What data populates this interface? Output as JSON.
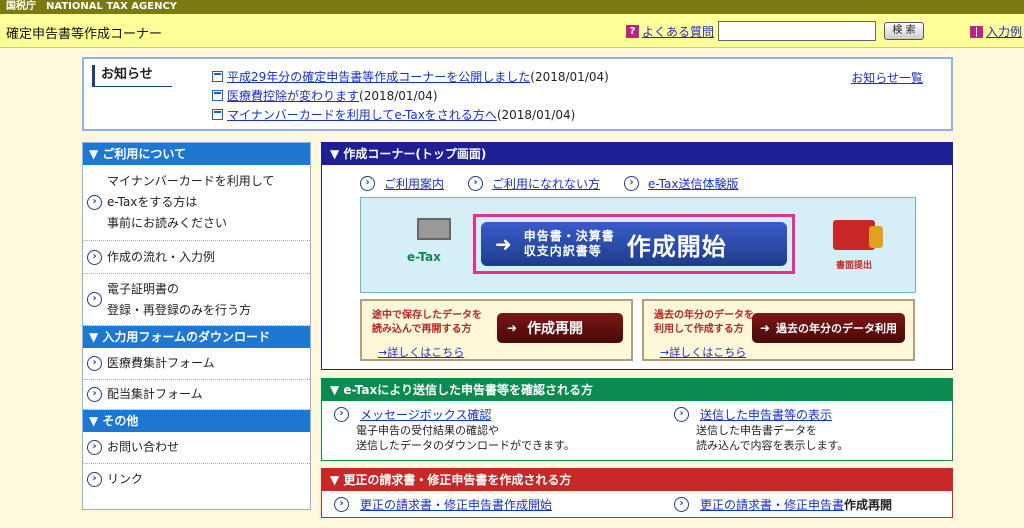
{
  "topbar": {
    "text": "国税庁　NATIONAL TAX AGENCY"
  },
  "header": {
    "title": "確定申告書等作成コーナー",
    "faq_label": "よくある質問",
    "search_button": "検 索",
    "input_example": "入力例"
  },
  "notice": {
    "label": "お知らせ",
    "all_link": "お知らせ一覧",
    "items": [
      {
        "link": "平成29年分の確定申告書等作成コーナーを公開しました",
        "date": "(2018/01/04)"
      },
      {
        "link": "医療費控除が変わります",
        "date": "(2018/01/04)"
      },
      {
        "link": "マイナンバーカードを利用してe-Taxをされる方へ",
        "date": "(2018/01/04)"
      }
    ]
  },
  "sidebar": {
    "sections": [
      {
        "heading": "▼ ご利用について",
        "items": [
          {
            "lines": [
              "マイナンバーカードを利用して",
              "e-Taxをする方は",
              "事前にお読みください"
            ]
          },
          {
            "lines": [
              "作成の流れ・入力例"
            ]
          },
          {
            "lines": [
              "電子証明書の",
              "登録・再登録のみを行う方"
            ]
          }
        ]
      },
      {
        "heading": "▼ 入力用フォームのダウンロード",
        "items": [
          {
            "lines": [
              "医療費集計フォーム"
            ]
          },
          {
            "lines": [
              "配当集計フォーム"
            ]
          }
        ]
      },
      {
        "heading": "▼ その他",
        "items": [
          {
            "lines": [
              "お問い合わせ"
            ]
          },
          {
            "lines": [
              "リンク"
            ]
          }
        ]
      }
    ]
  },
  "create": {
    "heading": "▼ 作成コーナー(トップ画面)",
    "links": [
      "ご利用案内",
      "ご利用になれない方",
      "e-Tax送信体験版"
    ],
    "etax_label": "e-Tax",
    "main_sub1": "申告書・決算書",
    "main_sub2": "収支内訳書等",
    "main_label": "作成開始",
    "shinsei_label": "書面提出",
    "resume": {
      "note1": "途中で保存したデータを",
      "note2": "読み込んで再開する方",
      "button": "作成再開",
      "detail": "→詳しくはこちら"
    },
    "past": {
      "note1": "過去の年分のデータを",
      "note2": "利用して作成する方",
      "button": "過去の年分のデータ利用",
      "detail": "→詳しくはこちら"
    }
  },
  "etax_box": {
    "heading": "▼ e-Taxにより送信した申告書等を確認される方",
    "left": {
      "link": "メッセージボックス確認",
      "desc1": "電子申告の受付結果の確認や",
      "desc2": "送信したデータのダウンロードができます。"
    },
    "right": {
      "link": "送信した申告書等の表示",
      "desc1": "送信した申告書データを",
      "desc2": "読み込んで内容を表示します。"
    }
  },
  "kousei": {
    "heading": "▼ 更正の請求書・修正申告書を作成される方",
    "left_link": "更正の請求書・修正申告書作成開始",
    "right_link": "更正の請求書・修正申告書",
    "right_suffix": "作成再開"
  },
  "colors": {
    "accent_blue": "#1E78D2",
    "navy": "#1E1E96",
    "green": "#0A8C50",
    "red": "#C82828",
    "pink": "#E8308C"
  }
}
